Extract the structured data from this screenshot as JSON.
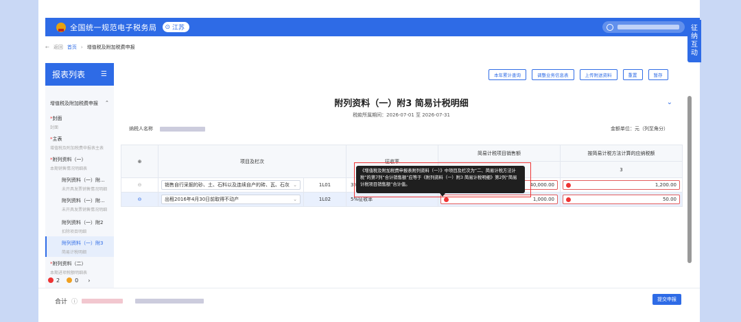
{
  "header": {
    "title": "全国统一规范电子税务局",
    "location": "江苏"
  },
  "side_tab": [
    "征",
    "纳",
    "互",
    "动"
  ],
  "breadcrumb": {
    "back": "返回",
    "home": "首页",
    "current": "增值税及附加税费申报"
  },
  "sidebar": {
    "title": "报表列表",
    "group": "增值税及附加税费申报",
    "items": [
      {
        "label": "封面",
        "sub": "封面",
        "req": "*"
      },
      {
        "label": "主表",
        "sub": "增值税及附加税费申报表主表",
        "req": "*"
      },
      {
        "label": "附列资料（一）",
        "sub": "本期销售情况明细表",
        "req": "*"
      },
      {
        "label": "附列资料（一）附...",
        "sub": "未开具发票销售情况明细",
        "req": ""
      },
      {
        "label": "附列资料（一）附...",
        "sub": "未开具发票销售情况明细",
        "req": ""
      },
      {
        "label": "附列资料（一）附2",
        "sub": "扣除项目明细",
        "req": ""
      },
      {
        "label": "附列资料（一）附3",
        "sub": "简易计税明细",
        "req": ""
      },
      {
        "label": "附列资料（二）",
        "sub": "本期进项税额明细表",
        "req": "*"
      }
    ],
    "footer": {
      "errors": "2",
      "warnings": "0"
    }
  },
  "toolbar": {
    "b1": "本年累计查询",
    "b2": "调整业务信息表",
    "b3": "上传附送资料",
    "b4": "重置",
    "b5": "暂存"
  },
  "report": {
    "title": "附列资料（一）附3 简易计税明细",
    "period": "税款所属期间：2026-07-01 至 2026-07-31",
    "taxpayer_label": "纳税人名称",
    "unit": "金额单位：元（列至角分）"
  },
  "table": {
    "h_item": "项目及栏次",
    "h_rate": "征收率",
    "h_sales": "简易计税项目销售额",
    "h_tax": "按简易计税方法计算的应纳税额",
    "col_num": "3",
    "rows": [
      {
        "item": "销售自行采掘的砂、土、石料以及连续自产的砖、瓦、石灰",
        "line": "1L01",
        "rate": "3%",
        "sales": "40,000.00",
        "tax": "1,200.00"
      },
      {
        "item": "出租2016年4月30日前取得不动产",
        "line": "1L02",
        "rate": "5%征收率",
        "sales": "1,000.00",
        "tax": "50.00"
      }
    ]
  },
  "tooltip": "《增值税及附加税费申报表附列资料（一）》中项目及栏次为“二、简易计税方法计税”的第7列“合计销售额”应等于《附列资料（一）附3 简易计税明细》第2列“简易计税项目销售额”合计值。",
  "bottom": {
    "total_label": "合计",
    "submit": "提交申报"
  }
}
